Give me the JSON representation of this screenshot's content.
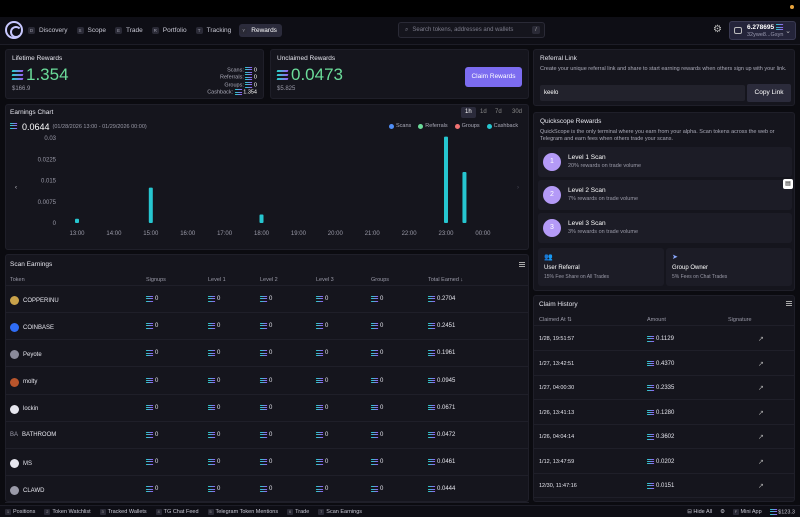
{
  "nav": {
    "tabs": [
      {
        "key": "D",
        "label": "Discovery",
        "active": false
      },
      {
        "key": "S",
        "label": "Scope",
        "active": false
      },
      {
        "key": "E",
        "label": "Trade",
        "active": false
      },
      {
        "key": "R",
        "label": "Portfolio",
        "active": false
      },
      {
        "key": "T",
        "label": "Tracking",
        "active": false
      },
      {
        "key": "Y",
        "label": "Rewards",
        "active": true
      }
    ],
    "search_placeholder": "Search tokens, addresses and wallets",
    "search_key": "/",
    "wallet_amount": "6.278695",
    "wallet_address": "32ywe8...Gsyn"
  },
  "lifetime": {
    "title": "Lifetime Rewards",
    "value": "1.354",
    "usd": "$166.9",
    "breakdown": [
      {
        "label": "Scans:",
        "value": "0"
      },
      {
        "label": "Referrals:",
        "value": "0"
      },
      {
        "label": "Groups:",
        "value": "0"
      },
      {
        "label": "Cashback:",
        "value": "1.354"
      }
    ]
  },
  "unclaimed": {
    "title": "Unclaimed Rewards",
    "value": "0.0473",
    "usd": "$5.825",
    "button": "Claim Rewards"
  },
  "chart": {
    "title": "Earnings Chart",
    "total": "0.0644",
    "range": "(01/28/2026 13:00 - 01/29/2026 00:00)",
    "timeframes": [
      "1h",
      "1d",
      "7d",
      "30d"
    ],
    "active_tf": "1h",
    "legend": [
      {
        "name": "Scans",
        "color": "#4f8ef7"
      },
      {
        "name": "Referrals",
        "color": "#6bdc9a"
      },
      {
        "name": "Groups",
        "color": "#f07272"
      },
      {
        "name": "Cashback",
        "color": "#26c6d0"
      }
    ],
    "prev_icon": "chevron-left-icon",
    "next_icon": "chevron-right-icon"
  },
  "chart_data": {
    "type": "bar",
    "categories": [
      "13:00",
      "14:00",
      "15:00",
      "16:00",
      "17:00",
      "18:00",
      "19:00",
      "20:00",
      "21:00",
      "22:00",
      "23:00",
      "00:00"
    ],
    "x": [
      13.0,
      15.0,
      18.0,
      23.0,
      23.5
    ],
    "values": [
      0.0015,
      0.0125,
      0.003,
      0.0305,
      0.018
    ],
    "series_color": "#26c6d0",
    "yticks": [
      "0",
      "0.0075",
      "0.015",
      "0.0225",
      "0.03"
    ],
    "ylim": [
      0,
      0.03
    ],
    "grid": false
  },
  "scan": {
    "title": "Scan Earnings",
    "columns": [
      "Token",
      "Signups",
      "Level 1",
      "Level 2",
      "Level 3",
      "Groups",
      "Total Earned"
    ],
    "sort_indicator": "↓",
    "rows": [
      {
        "token": "COPPERINU",
        "color": "#c9a24a",
        "prefix": "",
        "signups": "0",
        "l1": "0",
        "l2": "0",
        "l3": "0",
        "groups": "0",
        "total": "0.2704"
      },
      {
        "token": "COINBASE",
        "color": "#2f6df6",
        "prefix": "",
        "signups": "0",
        "l1": "0",
        "l2": "0",
        "l3": "0",
        "groups": "0",
        "total": "0.2451"
      },
      {
        "token": "Peyote",
        "color": "#8a8a9a",
        "prefix": "",
        "signups": "0",
        "l1": "0",
        "l2": "0",
        "l3": "0",
        "groups": "0",
        "total": "0.1961"
      },
      {
        "token": "molty",
        "color": "#b8552c",
        "prefix": "",
        "signups": "0",
        "l1": "0",
        "l2": "0",
        "l3": "0",
        "groups": "0",
        "total": "0.0945"
      },
      {
        "token": "lockin",
        "color": "#e6e6ee",
        "prefix": "",
        "signups": "0",
        "l1": "0",
        "l2": "0",
        "l3": "0",
        "groups": "0",
        "total": "0.0671"
      },
      {
        "token": "BATHROOM",
        "color": "#15151d",
        "prefix": "BA",
        "signups": "0",
        "l1": "0",
        "l2": "0",
        "l3": "0",
        "groups": "0",
        "total": "0.0472"
      },
      {
        "token": "MS",
        "color": "#e6e6ee",
        "prefix": "",
        "signups": "0",
        "l1": "0",
        "l2": "0",
        "l3": "0",
        "groups": "0",
        "total": "0.0461"
      },
      {
        "token": "CLAWD",
        "color": "#9a9aa8",
        "prefix": "",
        "signups": "0",
        "l1": "0",
        "l2": "0",
        "l3": "0",
        "groups": "0",
        "total": "0.0444"
      }
    ]
  },
  "referral": {
    "title": "Referral Link",
    "desc": "Create your unique referral link and share to start earning rewards when others sign up with your link.",
    "code": "keelo",
    "button": "Copy Link"
  },
  "quick": {
    "title": "Quickscope Rewards",
    "desc": "QuickScope is the only terminal where you earn from your alpha. Scan tokens across the web or Telegram and earn fees when others trade your scans.",
    "levels": [
      {
        "num": "1",
        "title": "Level 1 Scan",
        "sub": "20% rewards on trade volume"
      },
      {
        "num": "2",
        "title": "Level 2 Scan",
        "sub": "7% rewards on trade volume"
      },
      {
        "num": "3",
        "title": "Level 3 Scan",
        "sub": "3% rewards on trade volume"
      }
    ],
    "cards": [
      {
        "title": "User Referral",
        "sub": "15% Fee Share on All Trades"
      },
      {
        "title": "Group Owner",
        "sub": "5% Fees on Chat Trades"
      }
    ]
  },
  "claims": {
    "title": "Claim History",
    "columns": [
      "Claimed At",
      "Amount",
      "Signature"
    ],
    "rows": [
      {
        "at": "1/28, 19:51:57",
        "amount": "0.1129"
      },
      {
        "at": "1/27, 13:42:51",
        "amount": "0.4370"
      },
      {
        "at": "1/27, 04:00:30",
        "amount": "0.2335"
      },
      {
        "at": "1/26, 13:41:13",
        "amount": "0.1280"
      },
      {
        "at": "1/26, 04:04:14",
        "amount": "0.3602"
      },
      {
        "at": "1/12, 13:47:59",
        "amount": "0.0202"
      },
      {
        "at": "12/30, 11:47:16",
        "amount": "0.0151"
      }
    ]
  },
  "bottom": {
    "items": [
      {
        "key": "1",
        "label": "Positions"
      },
      {
        "key": "2",
        "label": "Token Watchlist"
      },
      {
        "key": "3",
        "label": "Tracked Wallets"
      },
      {
        "key": "4",
        "label": "TG Chat Feed"
      },
      {
        "key": "5",
        "label": "Telegram Token Mentions"
      },
      {
        "key": "6",
        "label": "Trade"
      },
      {
        "key": "7",
        "label": "Scan Earnings"
      }
    ],
    "hide_all": "Hide All",
    "mini_app": "Mini App",
    "price": "$123.3"
  }
}
